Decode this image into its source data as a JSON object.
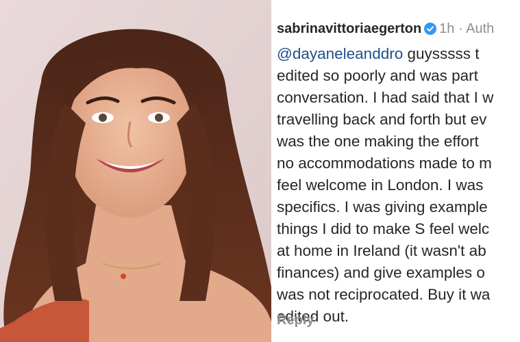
{
  "comment": {
    "username": "sabrinavittoriaegerton",
    "time": "1h",
    "separator": "·",
    "author_tag": "Auth",
    "mention": "@dayaneleanddro",
    "lines": [
      " guysssss t",
      "edited so poorly and was part",
      "conversation. I had said that I w",
      "travelling back and forth but ev",
      "was the one making the effort",
      "no accommodations made to m",
      "feel welcome in London. I was",
      "specifics. I was giving example",
      "things I did to make S feel welc",
      "at home in Ireland (it wasn't ab",
      "finances) and give examples o",
      "was not reciprocated. Buy it wa",
      "edited out."
    ],
    "reply_label": "Reply"
  },
  "icons": {
    "verified": "verified-badge-icon"
  },
  "colors": {
    "mention": "#1e4f8a",
    "verified": "#3897f0",
    "meta": "#8e8e8e",
    "text": "#262626"
  }
}
